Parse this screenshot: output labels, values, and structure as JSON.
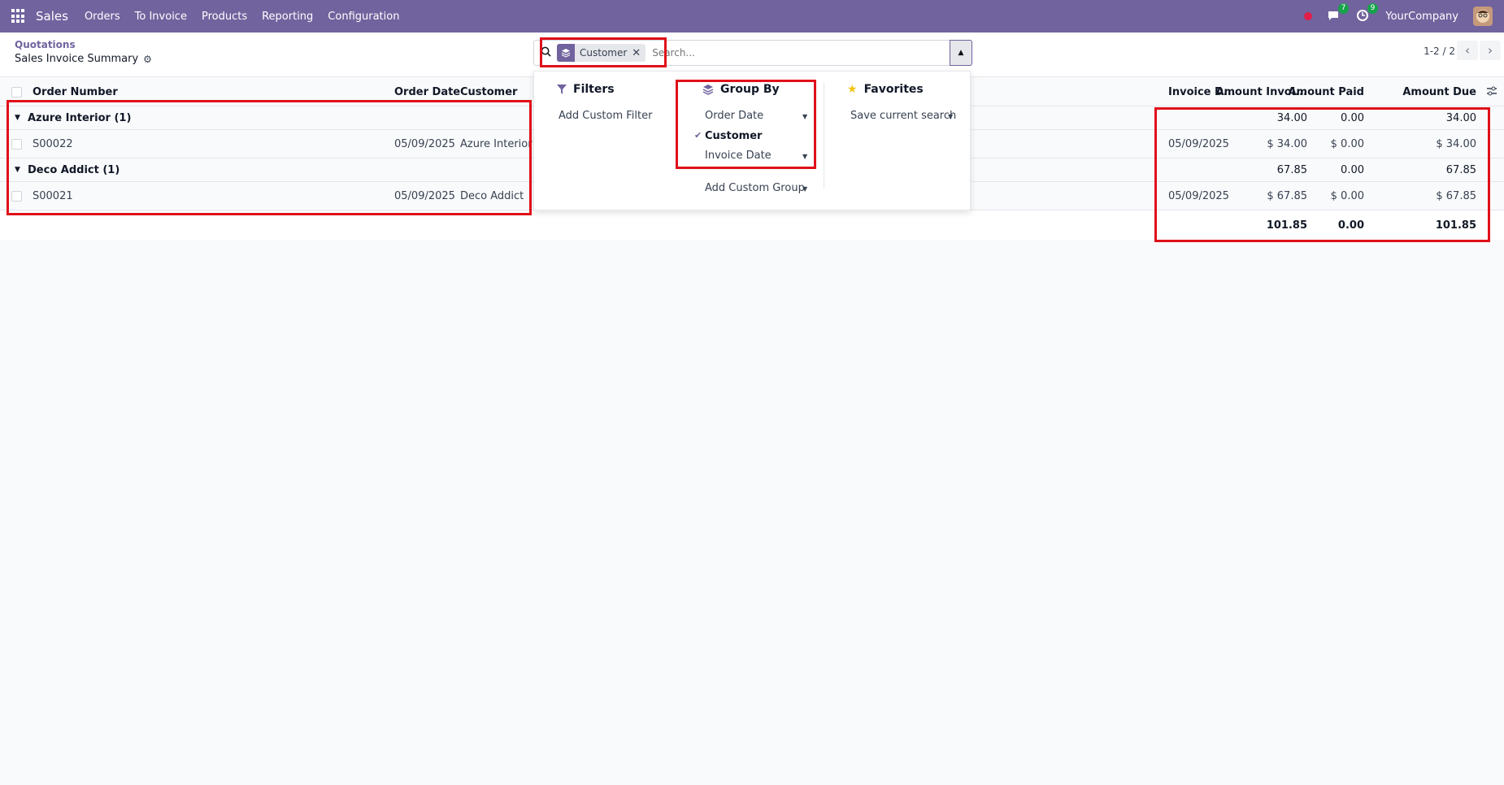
{
  "navbar": {
    "app_name": "Sales",
    "menu": [
      "Orders",
      "To Invoice",
      "Products",
      "Reporting",
      "Configuration"
    ],
    "messages_count": "7",
    "activities_count": "9",
    "company": "YourCompany"
  },
  "control_panel": {
    "breadcrumb": "Quotations",
    "title": "Sales Invoice Summary",
    "facet_label": "Customer",
    "search_placeholder": "Search...",
    "pager": "1-2 / 2"
  },
  "table": {
    "columns": {
      "order_number": "Order Number",
      "order_date": "Order Date",
      "customer": "Customer",
      "invoice_date": "Invoice D...",
      "amount_invoiced": "Amount Invoi...",
      "amount_paid": "Amount Paid",
      "amount_due": "Amount Due"
    },
    "groups": [
      {
        "label": "Azure Interior (1)",
        "amount_invoiced": "34.00",
        "amount_paid": "0.00",
        "amount_due": "34.00",
        "row": {
          "order_number": "S00022",
          "order_date": "05/09/2025",
          "customer": "Azure Interior",
          "invoice_date": "05/09/2025",
          "amount_invoiced": "$ 34.00",
          "amount_paid": "$ 0.00",
          "amount_due": "$ 34.00"
        }
      },
      {
        "label": "Deco Addict (1)",
        "amount_invoiced": "67.85",
        "amount_paid": "0.00",
        "amount_due": "67.85",
        "row": {
          "order_number": "S00021",
          "order_date": "05/09/2025",
          "customer": "Deco Addict",
          "invoice_date": "05/09/2025",
          "amount_invoiced": "$ 67.85",
          "amount_paid": "$ 0.00",
          "amount_due": "$ 67.85"
        }
      }
    ],
    "totals": {
      "amount_invoiced": "101.85",
      "amount_paid": "0.00",
      "amount_due": "101.85"
    }
  },
  "dropdown": {
    "filters": {
      "title": "Filters",
      "add_custom": "Add Custom Filter"
    },
    "group_by": {
      "title": "Group By",
      "items": [
        "Order Date",
        "Customer",
        "Invoice Date"
      ],
      "add_custom": "Add Custom Group"
    },
    "favorites": {
      "title": "Favorites",
      "save": "Save current search"
    }
  },
  "colors": {
    "brand": "#71639e",
    "highlight": "#e0101a"
  }
}
